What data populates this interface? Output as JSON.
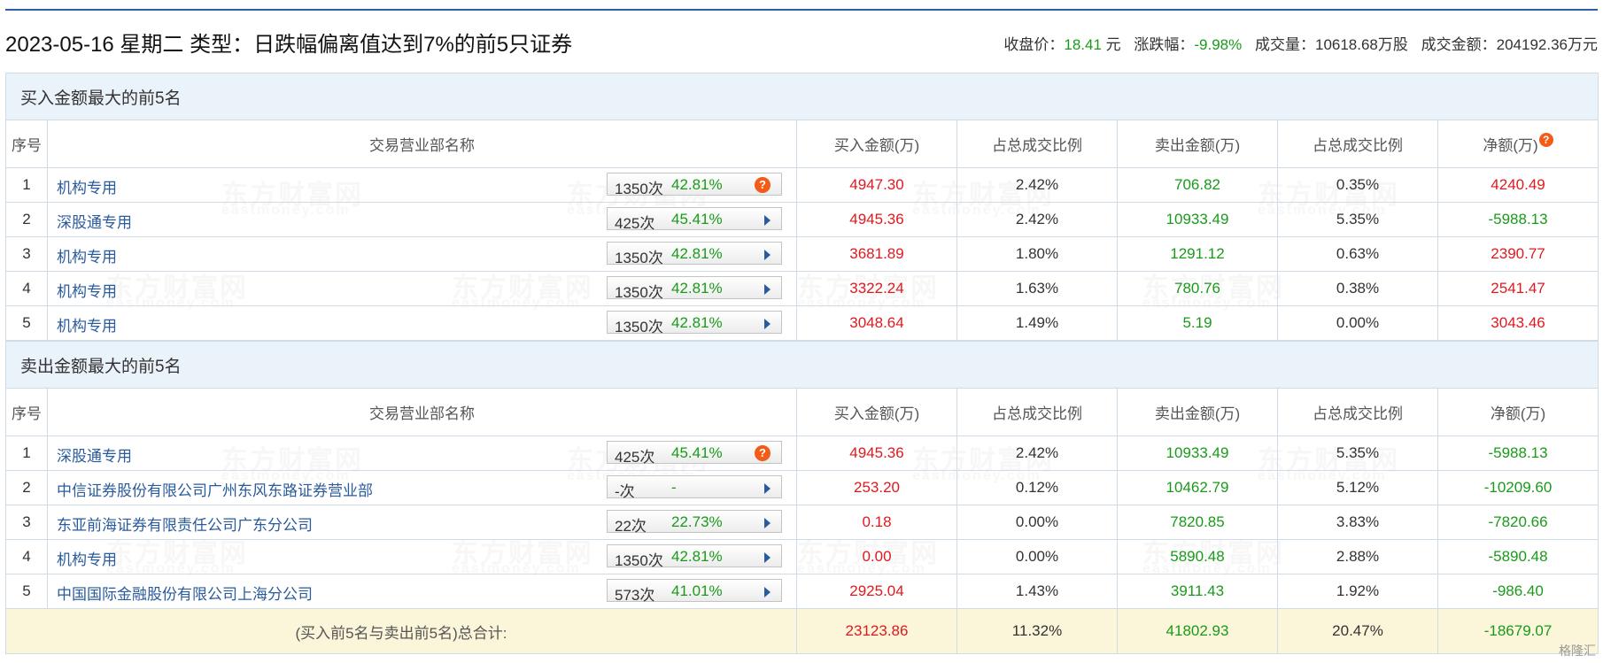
{
  "header": {
    "title": "2023-05-16 星期二 类型：日跌幅偏离值达到7%的前5只证券",
    "summary": {
      "close_label": "收盘价：",
      "close_value": "18.41",
      "close_unit": " 元",
      "change_label": "涨跌幅：",
      "change_value": "-9.98%",
      "volume_label": "成交量：",
      "volume_value": "10618.68万股",
      "amount_label": "成交金额：",
      "amount_value": "204192.36万元"
    }
  },
  "columns": {
    "index": "序号",
    "name": "交易营业部名称",
    "buy": "买入金额(万)",
    "buy_ratio": "占总成交比例",
    "sell": "卖出金额(万)",
    "sell_ratio": "占总成交比例",
    "net": "净额(万)"
  },
  "buy_section": {
    "title": "买入金额最大的前5名",
    "rows": [
      {
        "idx": "1",
        "name": "机构专用",
        "count": "1350次",
        "pct": "42.81%",
        "buy": "4947.30",
        "buy_ratio": "2.42%",
        "sell": "706.82",
        "sell_ratio": "0.35%",
        "net": "4240.49",
        "net_color": "red",
        "help": true
      },
      {
        "idx": "2",
        "name": "深股通专用",
        "count": "425次",
        "pct": "45.41%",
        "buy": "4945.36",
        "buy_ratio": "2.42%",
        "sell": "10933.49",
        "sell_ratio": "5.35%",
        "net": "-5988.13",
        "net_color": "green",
        "help": false
      },
      {
        "idx": "3",
        "name": "机构专用",
        "count": "1350次",
        "pct": "42.81%",
        "buy": "3681.89",
        "buy_ratio": "1.80%",
        "sell": "1291.12",
        "sell_ratio": "0.63%",
        "net": "2390.77",
        "net_color": "red",
        "help": false
      },
      {
        "idx": "4",
        "name": "机构专用",
        "count": "1350次",
        "pct": "42.81%",
        "buy": "3322.24",
        "buy_ratio": "1.63%",
        "sell": "780.76",
        "sell_ratio": "0.38%",
        "net": "2541.47",
        "net_color": "red",
        "help": false
      },
      {
        "idx": "5",
        "name": "机构专用",
        "count": "1350次",
        "pct": "42.81%",
        "buy": "3048.64",
        "buy_ratio": "1.49%",
        "sell": "5.19",
        "sell_ratio": "0.00%",
        "net": "3043.46",
        "net_color": "red",
        "help": false
      }
    ]
  },
  "sell_section": {
    "title": "卖出金额最大的前5名",
    "rows": [
      {
        "idx": "1",
        "name": "深股通专用",
        "count": "425次",
        "pct": "45.41%",
        "buy": "4945.36",
        "buy_ratio": "2.42%",
        "sell": "10933.49",
        "sell_ratio": "5.35%",
        "net": "-5988.13",
        "net_color": "green",
        "help": true
      },
      {
        "idx": "2",
        "name": "中信证券股份有限公司广州东风东路证券营业部",
        "count": "-次",
        "pct": "-",
        "buy": "253.20",
        "buy_ratio": "0.12%",
        "sell": "10462.79",
        "sell_ratio": "5.12%",
        "net": "-10209.60",
        "net_color": "green",
        "help": false
      },
      {
        "idx": "3",
        "name": "东亚前海证券有限责任公司广东分公司",
        "count": "22次",
        "pct": "22.73%",
        "buy": "0.18",
        "buy_ratio": "0.00%",
        "sell": "7820.85",
        "sell_ratio": "3.83%",
        "net": "-7820.66",
        "net_color": "green",
        "help": false
      },
      {
        "idx": "4",
        "name": "机构专用",
        "count": "1350次",
        "pct": "42.81%",
        "buy": "0.00",
        "buy_ratio": "0.00%",
        "sell": "5890.48",
        "sell_ratio": "2.88%",
        "net": "-5890.48",
        "net_color": "green",
        "help": false
      },
      {
        "idx": "5",
        "name": "中国国际金融股份有限公司上海分公司",
        "count": "573次",
        "pct": "41.01%",
        "buy": "2925.04",
        "buy_ratio": "1.43%",
        "sell": "3911.43",
        "sell_ratio": "1.92%",
        "net": "-986.40",
        "net_color": "green",
        "help": false
      }
    ]
  },
  "total": {
    "label": "(买入前5名与卖出前5名)总合计:",
    "buy": "23123.86",
    "buy_ratio": "11.32%",
    "sell": "41802.93",
    "sell_ratio": "20.47%",
    "net": "-18679.07"
  },
  "icons": {
    "help": "help-question-icon",
    "expand": "expand-arrow-icon"
  },
  "watermark": {
    "cn": "东方财富网",
    "en": "eastmoney.com"
  },
  "source_logo": "格隆汇",
  "colors": {
    "up": "#e0191f",
    "down": "#1a9a1a",
    "link": "#2a5b9c",
    "section_bg": "#eaf2fa",
    "total_bg": "#fbf5d9",
    "help": "#f25b18"
  }
}
